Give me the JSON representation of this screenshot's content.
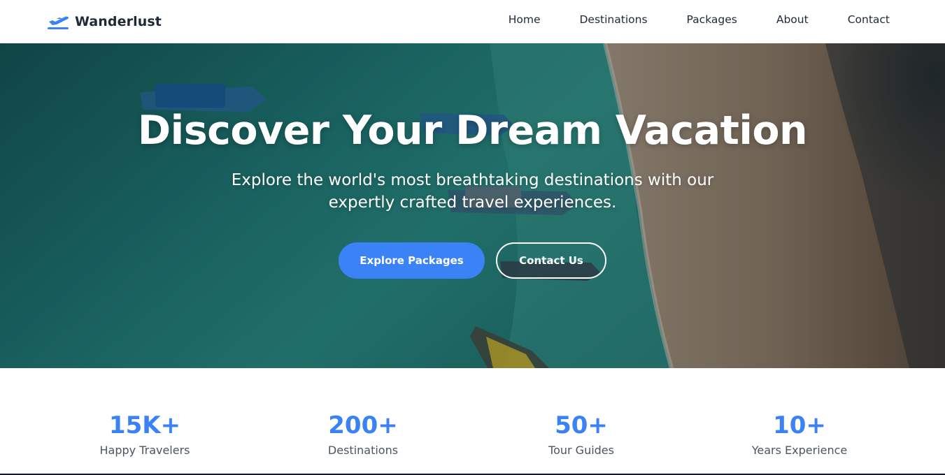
{
  "brand": {
    "name": "Wanderlust",
    "icon": "airplane-icon",
    "color": "#3b82f6"
  },
  "nav": {
    "items": [
      {
        "label": "Home"
      },
      {
        "label": "Destinations"
      },
      {
        "label": "Packages"
      },
      {
        "label": "About"
      },
      {
        "label": "Contact"
      }
    ]
  },
  "hero": {
    "title": "Discover Your Dream Vacation",
    "subtitle": "Explore the world's most breathtaking destinations with our expertly crafted travel experiences.",
    "primary_button": "Explore Packages",
    "secondary_button": "Contact Us",
    "background": "aerial-beach-photo"
  },
  "stats": [
    {
      "value": "15K+",
      "label": "Happy Travelers"
    },
    {
      "value": "200+",
      "label": "Destinations"
    },
    {
      "value": "50+",
      "label": "Tour Guides"
    },
    {
      "value": "10+",
      "label": "Years Experience"
    }
  ],
  "colors": {
    "accent": "#3b82f6",
    "text_dark": "#1f2937",
    "text_muted": "#4b5563"
  }
}
